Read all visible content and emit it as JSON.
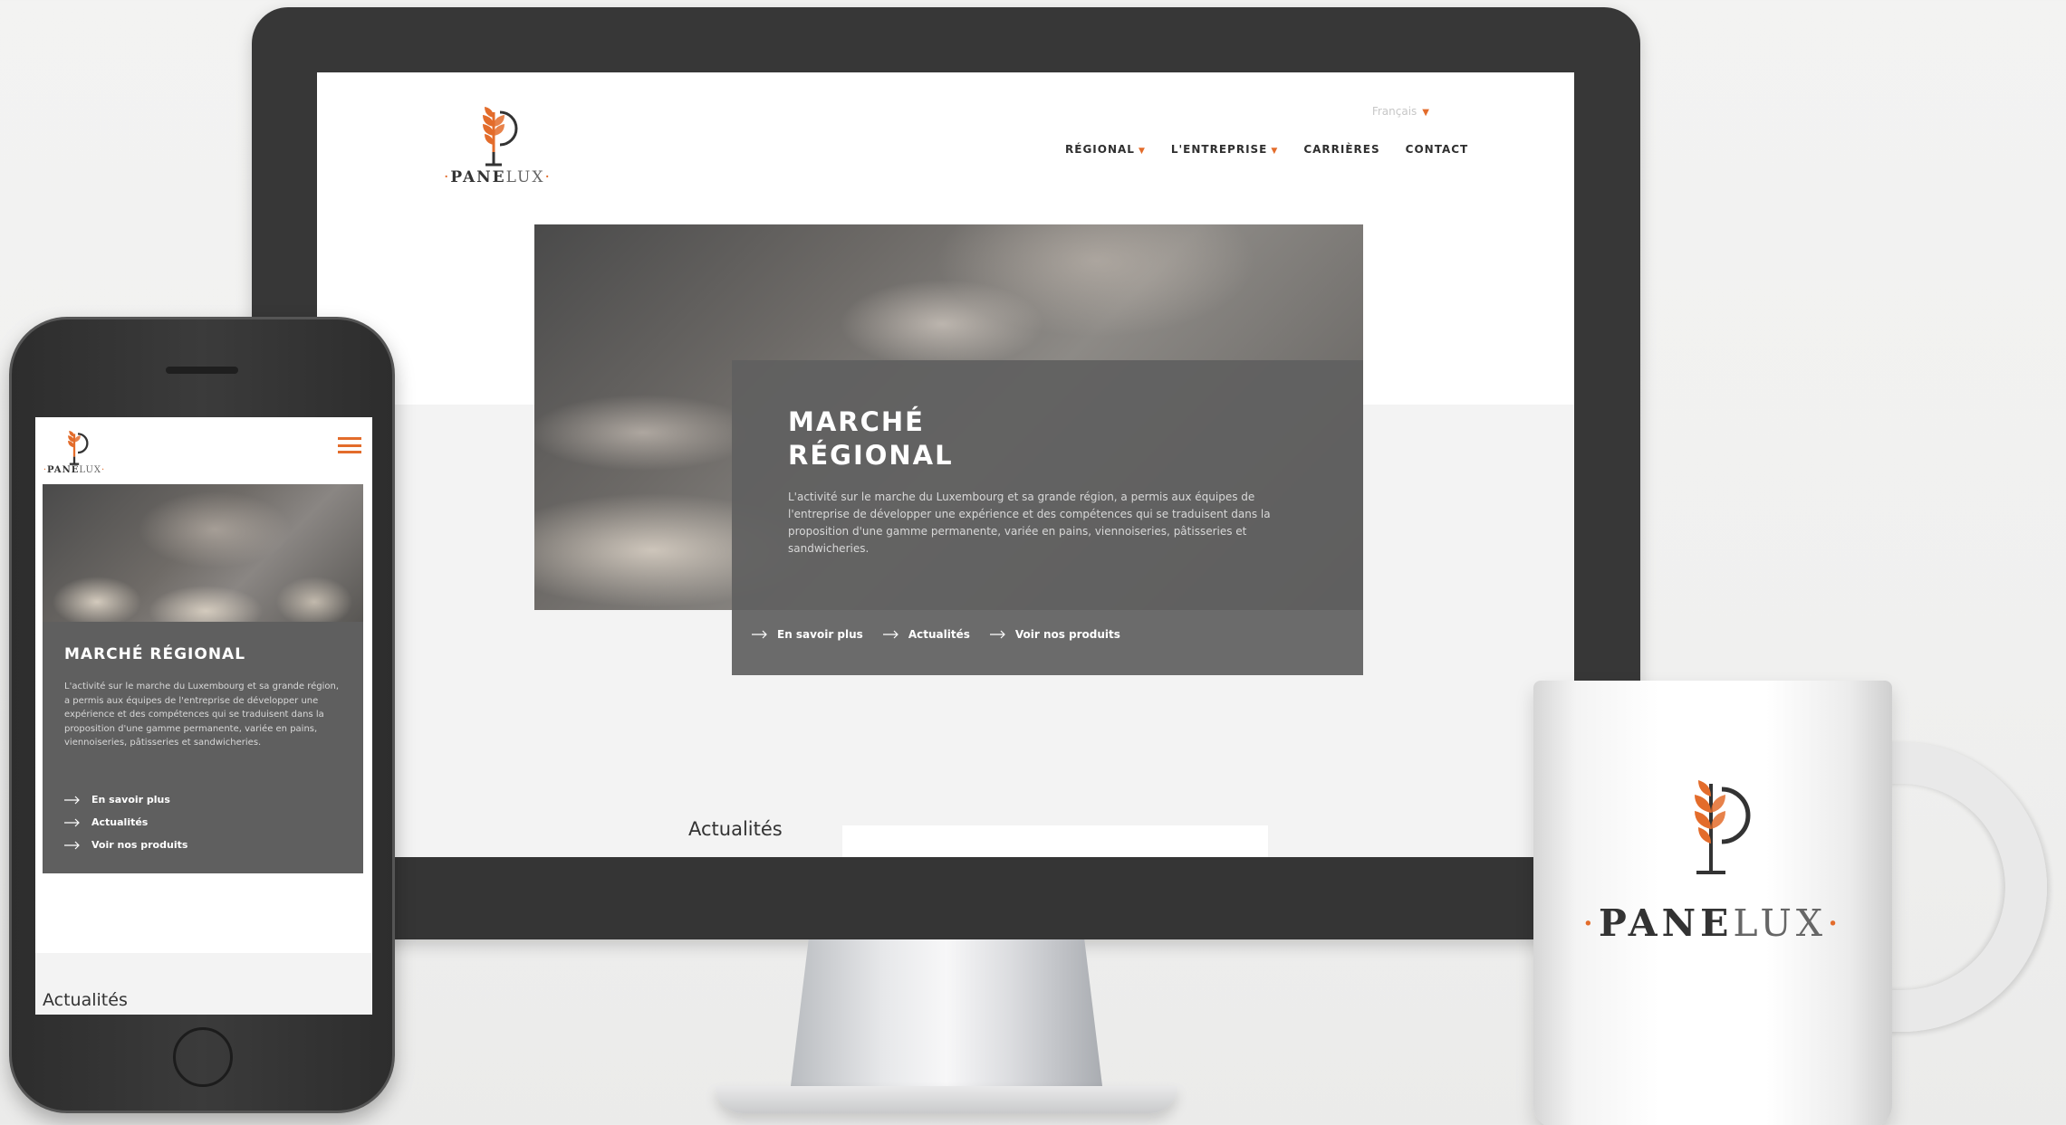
{
  "desktop": {
    "brand": {
      "dot": "·",
      "bold": "PANE",
      "light": "LUX"
    },
    "language": "Français",
    "nav": [
      {
        "label": "RÉGIONAL",
        "has_dropdown": true
      },
      {
        "label": "L'ENTREPRISE",
        "has_dropdown": true
      },
      {
        "label": "CARRIÈRES",
        "has_dropdown": false
      },
      {
        "label": "CONTACT",
        "has_dropdown": false
      }
    ],
    "hero": {
      "title_line1": "MARCHÉ",
      "title_line2": "RÉGIONAL",
      "text": "L'activité sur le marche du Luxembourg et sa grande région, a permis aux équipes de l'entreprise de développer une expérience et des compétences qui se traduisent dans la proposition d'une gamme permanente, variée en pains, viennoiseries, pâtisseries et sandwicheries.",
      "links": [
        "En savoir plus",
        "Actualités",
        "Voir nos produits"
      ]
    },
    "news_label": "Actualités"
  },
  "mobile": {
    "brand": {
      "bold": "PANE",
      "light": "LUX"
    },
    "hero": {
      "title": "MARCHÉ RÉGIONAL",
      "text": "L'activité sur le marche du Luxembourg et sa grande région, a permis aux équipes de l'entreprise de développer une expérience et des compétences qui se traduisent dans la proposition d'une gamme permanente, variée en pains, viennoiseries, pâtisseries et sandwicheries.",
      "links": [
        "En savoir plus",
        "Actualités",
        "Voir nos produits"
      ]
    },
    "news_label": "Actualités"
  },
  "mug": {
    "brand": {
      "bold": "PANE",
      "light": "LUX"
    }
  },
  "colors": {
    "accent": "#e36c2b",
    "card": "#606060",
    "device": "#373737"
  }
}
